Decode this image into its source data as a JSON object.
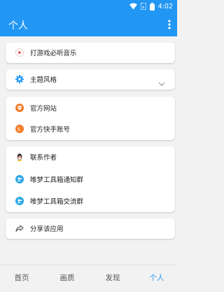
{
  "status_bar": {
    "time": "4:02"
  },
  "app_bar": {
    "title": "个人"
  },
  "menu": {
    "play_music": "打游戏必听音乐",
    "theme_style": "主题风格",
    "official_site": "官方网站",
    "official_kuaishou": "官方快手账号",
    "contact_author": "联系作者",
    "notify_group": "唯梦工具箱通知群",
    "chat_group": "唯梦工具箱交流群",
    "share_app": "分享该应用"
  },
  "bottom_nav": {
    "home": "首页",
    "quality": "画质",
    "discover": "发现",
    "profile": "个人"
  },
  "colors": {
    "primary": "#2196f3",
    "orange": "#f57c2b",
    "red": "#e53935"
  }
}
